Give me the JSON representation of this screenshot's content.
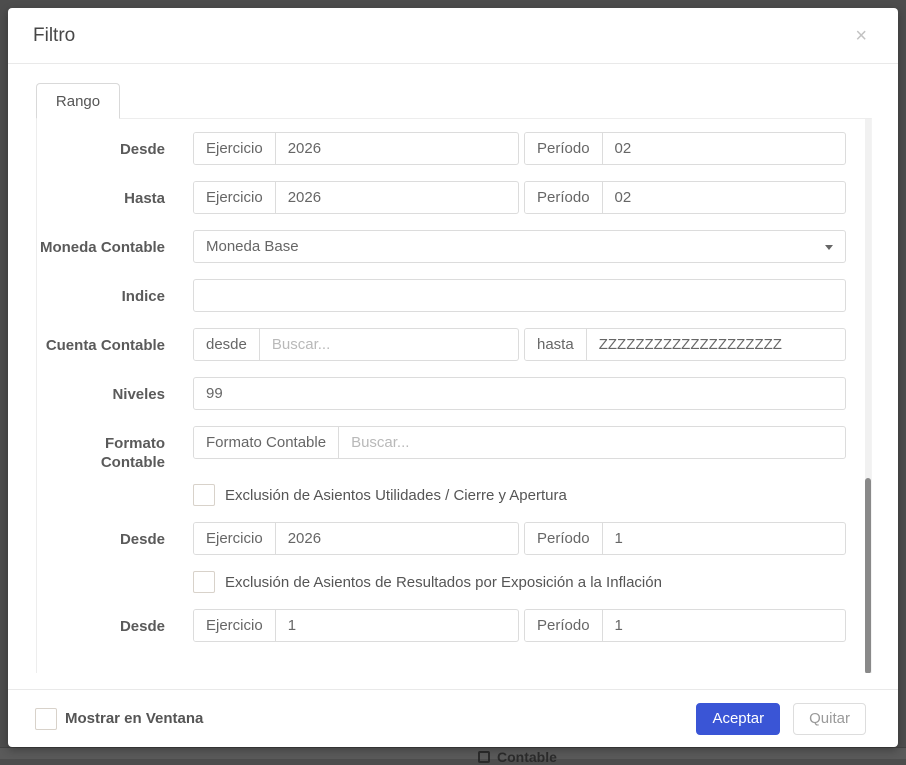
{
  "colors": {
    "accent": "#3a55d6",
    "backdrop": "#4d4d4d",
    "scroll_thumb": "#898989"
  },
  "background": {
    "hint_text": "Contable"
  },
  "modal": {
    "title": "Filtro",
    "close_icon": "×",
    "tabs": [
      {
        "label": "Rango",
        "active": true
      }
    ],
    "form": {
      "rows": [
        {
          "label": "Desde",
          "field1": {
            "addon": "Ejercicio",
            "value": "2026"
          },
          "field2": {
            "addon": "Período",
            "value": "02"
          }
        },
        {
          "label": "Hasta",
          "field1": {
            "addon": "Ejercicio",
            "value": "2026"
          },
          "field2": {
            "addon": "Período",
            "value": "02"
          }
        },
        {
          "label": "Moneda Contable",
          "type": "select",
          "value": "Moneda Base"
        },
        {
          "label": "Indice",
          "value": ""
        },
        {
          "label": "Cuenta Contable",
          "field1": {
            "addon": "desde",
            "placeholder": "Buscar..."
          },
          "field2": {
            "addon": "hasta",
            "value": "ZZZZZZZZZZZZZZZZZZZZ"
          }
        },
        {
          "label": "Niveles",
          "value": "99"
        },
        {
          "label": "Formato Contable",
          "addon": "Formato Contable",
          "placeholder": "Buscar..."
        },
        {
          "type": "checkbox",
          "label": "Exclusión de Asientos Utilidades / Cierre y Apertura",
          "checked": false
        },
        {
          "label": "Desde",
          "field1": {
            "addon": "Ejercicio",
            "value": "2026"
          },
          "field2": {
            "addon": "Período",
            "value": "1"
          }
        },
        {
          "type": "checkbox",
          "label": "Exclusión de Asientos de Resultados por Exposición a la Inflación",
          "checked": false
        },
        {
          "label": "Desde",
          "field1": {
            "addon": "Ejercicio",
            "value": "1"
          },
          "field2": {
            "addon": "Período",
            "value": "1"
          }
        }
      ]
    },
    "footer": {
      "checkbox_label": "Mostrar en Ventana",
      "checkbox_checked": false,
      "accept_label": "Aceptar",
      "remove_label": "Quitar"
    }
  }
}
